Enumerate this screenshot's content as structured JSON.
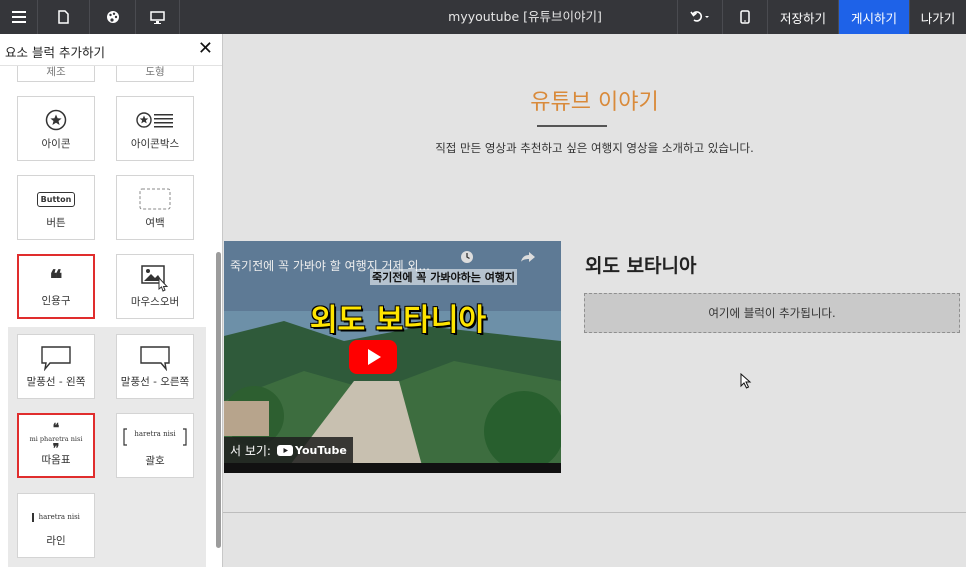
{
  "toolbar": {
    "title": "myyoutube [유튜브이야기]",
    "save_label": "저장하기",
    "publish_label": "게시하기",
    "exit_label": "나가기",
    "icons": [
      "menu-icon",
      "file-icon",
      "palette-icon",
      "monitor-icon",
      "undo-icon",
      "mobile-icon"
    ],
    "colors": {
      "bar": "#35363a",
      "publish": "#1e62e8"
    }
  },
  "panel": {
    "title": "요소 블럭 추가하기",
    "close_label": "✕",
    "partial_items": [
      "제조",
      "도형"
    ],
    "items": [
      {
        "label": "아이콘",
        "icon": "star-circle-icon",
        "selected": false
      },
      {
        "label": "아이콘박스",
        "icon": "icon-box-icon",
        "selected": false
      },
      {
        "label": "버튼",
        "icon": "button-icon",
        "icon_text": "Button",
        "selected": false
      },
      {
        "label": "여백",
        "icon": "spacer-icon",
        "selected": false
      },
      {
        "label": "인용구",
        "icon": "quote-icon",
        "selected": true
      },
      {
        "label": "마우스오버",
        "icon": "image-hover-icon",
        "selected": false
      },
      {
        "label": "말풍선 - 왼쪽",
        "icon": "speech-bubble-left-icon",
        "selected": false
      },
      {
        "label": "말풍선 - 오른쪽",
        "icon": "speech-bubble-right-icon",
        "selected": false
      },
      {
        "label": "따옴표",
        "icon": "quotation-marks-icon",
        "icon_text": "mi pharetra nisi",
        "selected": true
      },
      {
        "label": "괄호",
        "icon": "brackets-icon",
        "icon_text": "haretra nisi",
        "selected": false
      },
      {
        "label": "라인",
        "icon": "line-icon",
        "icon_text": "haretra nisi",
        "selected": false
      }
    ]
  },
  "main": {
    "heading": "유튜브 이야기",
    "subtitle": "직접 만든 영상과 추천하고 싶은 여행지 영상을 소개하고 있습니다.",
    "video": {
      "top_text": "죽기전에 꼭 가봐야 할 여행지 거제 외...",
      "subtitle_text": "죽기전에 꼭 가봐야하는 여행지",
      "big_title": "외도 보타니아",
      "bottom_text": "서 보기:",
      "platform": "YouTube"
    },
    "right_title": "외도 보타니아",
    "drop_zone": "여기에 블럭이 추가됩니다."
  }
}
